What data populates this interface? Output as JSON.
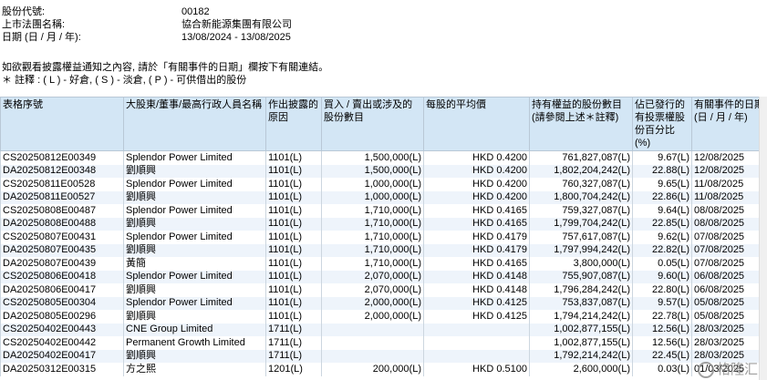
{
  "info": [
    {
      "label": "股份代號:",
      "value": "00182"
    },
    {
      "label": "上市法團名稱:",
      "value": "協合新能源集團有限公司"
    },
    {
      "label": "日期 (日 / 月 / 年):",
      "value": "13/08/2024 - 13/08/2025"
    }
  ],
  "notes": {
    "line1_prefix": "如欲觀看披露權益通知之內容, 請於「有關事件的日期」欄按下有關連結。",
    "line2": "＊ 註釋 : ( L ) - 好倉, ( S ) - 淡倉, ( P ) - 可供借出的股份"
  },
  "table": {
    "headers": [
      "表格序號",
      "大股東/董事/最高行政人員名稱",
      "作出披露的原因",
      "買入 / 賣出或涉及的股份數目",
      "每股的平均價",
      "持有權益的股份數目 (請參閱上述＊註釋)",
      "佔已發行的有投票權股份百分比 (%)",
      "有關事件的日期 (日 / 月 / 年)"
    ],
    "rows": [
      {
        "form": "CS20250812E00349",
        "name": "Splendor Power Limited",
        "reason": "1101(L)",
        "shares": "1,500,000(L)",
        "price": "HKD 0.4200",
        "held": "761,827,087(L)",
        "pct": "9.67(L)",
        "date": "12/08/2025"
      },
      {
        "form": "DA20250812E00348",
        "name": "劉順興",
        "reason": "1101(L)",
        "shares": "1,500,000(L)",
        "price": "HKD 0.4200",
        "held": "1,802,204,242(L)",
        "pct": "22.88(L)",
        "date": "12/08/2025"
      },
      {
        "form": "CS20250811E00528",
        "name": "Splendor Power Limited",
        "reason": "1101(L)",
        "shares": "1,000,000(L)",
        "price": "HKD 0.4200",
        "held": "760,327,087(L)",
        "pct": "9.65(L)",
        "date": "11/08/2025"
      },
      {
        "form": "DA20250811E00527",
        "name": "劉順興",
        "reason": "1101(L)",
        "shares": "1,000,000(L)",
        "price": "HKD 0.4200",
        "held": "1,800,704,242(L)",
        "pct": "22.86(L)",
        "date": "11/08/2025"
      },
      {
        "form": "CS20250808E00487",
        "name": "Splendor Power Limited",
        "reason": "1101(L)",
        "shares": "1,710,000(L)",
        "price": "HKD 0.4165",
        "held": "759,327,087(L)",
        "pct": "9.64(L)",
        "date": "08/08/2025"
      },
      {
        "form": "DA20250808E00488",
        "name": "劉順興",
        "reason": "1101(L)",
        "shares": "1,710,000(L)",
        "price": "HKD 0.4165",
        "held": "1,799,704,242(L)",
        "pct": "22.85(L)",
        "date": "08/08/2025"
      },
      {
        "form": "CS20250807E00431",
        "name": "Splendor Power Limited",
        "reason": "1101(L)",
        "shares": "1,710,000(L)",
        "price": "HKD 0.4179",
        "held": "757,617,087(L)",
        "pct": "9.62(L)",
        "date": "07/08/2025"
      },
      {
        "form": "DA20250807E00435",
        "name": "劉順興",
        "reason": "1101(L)",
        "shares": "1,710,000(L)",
        "price": "HKD 0.4179",
        "held": "1,797,994,242(L)",
        "pct": "22.82(L)",
        "date": "07/08/2025"
      },
      {
        "form": "DA20250807E00439",
        "name": "黃簡",
        "reason": "1101(L)",
        "shares": "1,710,000(L)",
        "price": "HKD 0.4165",
        "held": "3,800,000(L)",
        "pct": "0.05(L)",
        "date": "07/08/2025"
      },
      {
        "form": "CS20250806E00418",
        "name": "Splendor Power Limited",
        "reason": "1101(L)",
        "shares": "2,070,000(L)",
        "price": "HKD 0.4148",
        "held": "755,907,087(L)",
        "pct": "9.60(L)",
        "date": "06/08/2025"
      },
      {
        "form": "DA20250806E00417",
        "name": "劉順興",
        "reason": "1101(L)",
        "shares": "2,070,000(L)",
        "price": "HKD 0.4148",
        "held": "1,796,284,242(L)",
        "pct": "22.80(L)",
        "date": "06/08/2025"
      },
      {
        "form": "CS20250805E00304",
        "name": "Splendor Power Limited",
        "reason": "1101(L)",
        "shares": "2,000,000(L)",
        "price": "HKD 0.4125",
        "held": "753,837,087(L)",
        "pct": "9.57(L)",
        "date": "05/08/2025"
      },
      {
        "form": "DA20250805E00296",
        "name": "劉順興",
        "reason": "1101(L)",
        "shares": "2,000,000(L)",
        "price": "HKD 0.4125",
        "held": "1,794,214,242(L)",
        "pct": "22.78(L)",
        "date": "05/08/2025"
      },
      {
        "form": "CS20250402E00443",
        "name": "CNE Group Limited",
        "reason": "1711(L)",
        "shares": "",
        "price": "",
        "held": "1,002,877,155(L)",
        "pct": "12.56(L)",
        "date": "28/03/2025"
      },
      {
        "form": "CS20250402E00442",
        "name": "Permanent Growth Limited",
        "reason": "1711(L)",
        "shares": "",
        "price": "",
        "held": "1,002,877,155(L)",
        "pct": "12.56(L)",
        "date": "28/03/2025"
      },
      {
        "form": "DA20250402E00417",
        "name": "劉順興",
        "reason": "1711(L)",
        "shares": "",
        "price": "",
        "held": "1,792,214,242(L)",
        "pct": "22.45(L)",
        "date": "28/03/2025"
      },
      {
        "form": "DA20250312E00315",
        "name": "方之熙",
        "reason": "1201(L)",
        "shares": "200,000(L)",
        "price": "HKD 0.5100",
        "held": "2,600,000(L)",
        "pct": "0.03(L)",
        "date": "01/03/2025"
      }
    ]
  },
  "watermark": "格隆汇"
}
